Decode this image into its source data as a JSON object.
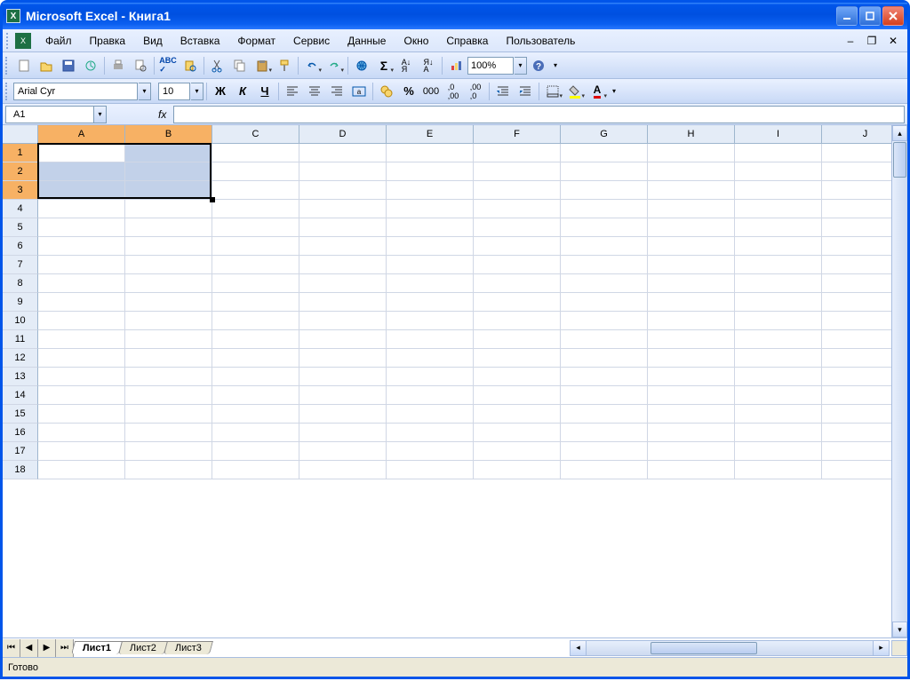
{
  "title": "Microsoft Excel - Книга1",
  "menu": {
    "file": "Файл",
    "edit": "Правка",
    "view": "Вид",
    "insert": "Вставка",
    "format": "Формат",
    "tools": "Сервис",
    "data": "Данные",
    "window": "Окно",
    "help": "Справка",
    "user": "Пользователь"
  },
  "toolbar": {
    "zoom": "100%"
  },
  "formatbar": {
    "font": "Arial Cyr",
    "size": "10",
    "bold": "Ж",
    "italic": "К",
    "underline": "Ч",
    "percent": "%",
    "thousands": "000"
  },
  "namebox": "A1",
  "fx": "fx",
  "columns": [
    "A",
    "B",
    "C",
    "D",
    "E",
    "F",
    "G",
    "H",
    "I",
    "J"
  ],
  "rows": [
    "1",
    "2",
    "3",
    "4",
    "5",
    "6",
    "7",
    "8",
    "9",
    "10",
    "11",
    "12",
    "13",
    "14",
    "15",
    "16",
    "17",
    "18"
  ],
  "selected_cols": [
    "A",
    "B"
  ],
  "selected_rows": [
    "1",
    "2",
    "3"
  ],
  "active_cell": "A1",
  "sheets": {
    "tabs": [
      "Лист1",
      "Лист2",
      "Лист3"
    ],
    "active": 0
  },
  "status": "Готово"
}
